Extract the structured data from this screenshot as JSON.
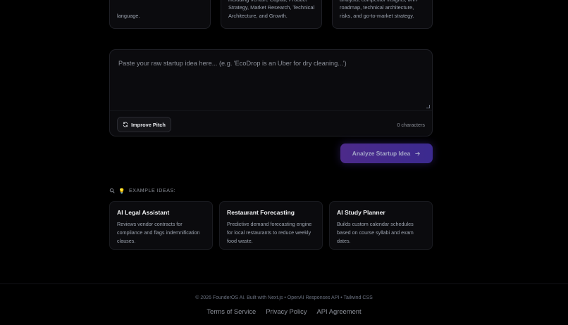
{
  "feature_cards": [
    {
      "text": "language."
    },
    {
      "text": "including Venture Capital, Product Strategy, Market Research, Technical Architecture, and Growth."
    },
    {
      "text": "analysis, competitor insights, MVP roadmap, technical architecture, risks, and go-to-market strategy."
    }
  ],
  "idea_input": {
    "placeholder": "Paste your raw startup idea here... (e.g. 'EcoDrop is an Uber for dry cleaning...')",
    "value": "",
    "improve_label": "Improve Pitch",
    "char_count": "0 characters"
  },
  "analyze_button": {
    "label": "Analyze Startup Idea",
    "icon": "arrow-right-icon"
  },
  "examples": {
    "header": "EXAMPLE IDEAS:",
    "items": [
      {
        "title": "AI Legal Assistant",
        "description": "Reviews vendor contracts for compliance and flags indemnification clauses."
      },
      {
        "title": "Restaurant Forecasting",
        "description": "Predictive demand forecasting engine for local restaurants to reduce weekly food waste."
      },
      {
        "title": "AI Study Planner",
        "description": "Builds custom calendar schedules based on course syllabi and exam dates."
      }
    ]
  },
  "footer": {
    "copyright": "© 2026 FounderOS AI. Built with Next.js • OpenAI Responses API • Tailwind CSS",
    "links": [
      "Terms of Service",
      "Privacy Policy",
      "API Agreement"
    ]
  },
  "colors": {
    "background": "#000000",
    "card": "#0b0b0e",
    "accent_start": "#4c2a8a",
    "accent_end": "#3b2a8f"
  }
}
